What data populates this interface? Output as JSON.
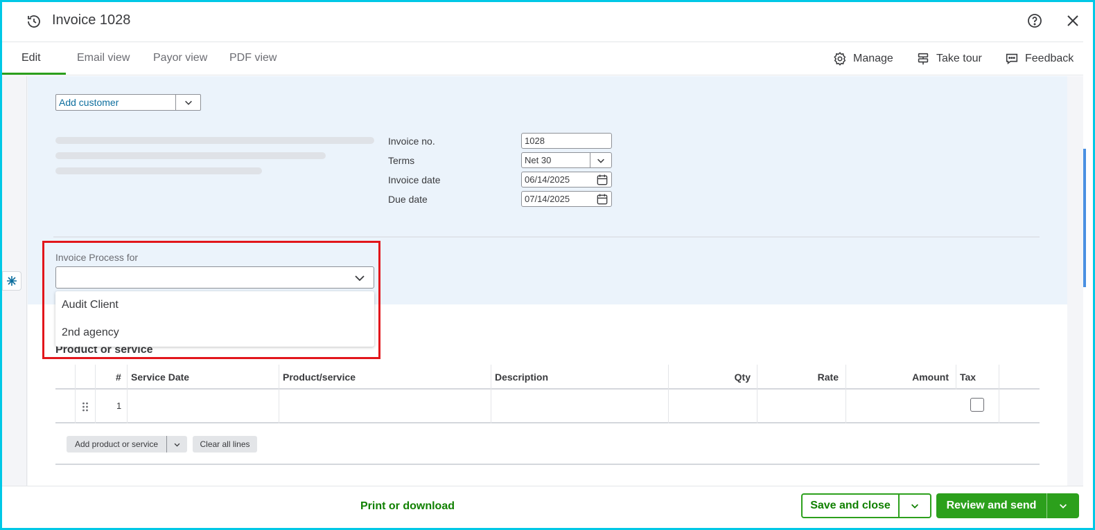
{
  "header": {
    "title": "Invoice 1028"
  },
  "tabs": [
    {
      "label": "Edit",
      "active": true
    },
    {
      "label": "Email view"
    },
    {
      "label": "Payor view"
    },
    {
      "label": "PDF view"
    }
  ],
  "tools": {
    "manage": "Manage",
    "take_tour": "Take tour",
    "feedback": "Feedback"
  },
  "customer": {
    "placeholder": "Add customer"
  },
  "invoice_fields": {
    "invoice_no_label": "Invoice no.",
    "invoice_no_value": "1028",
    "terms_label": "Terms",
    "terms_value": "Net 30",
    "invoice_date_label": "Invoice date",
    "invoice_date_value": "06/14/2025",
    "due_date_label": "Due date",
    "due_date_value": "07/14/2025"
  },
  "process": {
    "label": "Invoice Process for",
    "options": [
      "Audit Client",
      "2nd agency"
    ]
  },
  "products": {
    "section_title": "Product or service",
    "columns": {
      "num": "#",
      "service_date": "Service Date",
      "product": "Product/service",
      "description": "Description",
      "qty": "Qty",
      "rate": "Rate",
      "amount": "Amount",
      "tax": "Tax"
    },
    "rows": [
      {
        "num": "1"
      }
    ],
    "add_button": "Add product or service",
    "clear_button": "Clear all lines"
  },
  "footer": {
    "print": "Print or download",
    "save_close": "Save and close",
    "review_send": "Review and send"
  },
  "colors": {
    "accent_green": "#2ca01c",
    "link_green": "#108000",
    "highlight_red": "#e2161b",
    "panel_blue": "#ebf3fb"
  }
}
